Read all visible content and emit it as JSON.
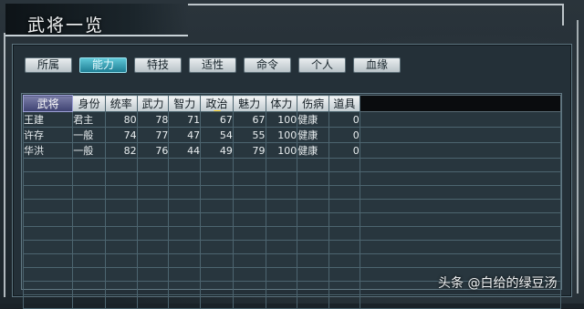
{
  "window": {
    "title": "武将一览"
  },
  "tabs": [
    {
      "label": "所属",
      "active": false
    },
    {
      "label": "能力",
      "active": true
    },
    {
      "label": "特技",
      "active": false
    },
    {
      "label": "适性",
      "active": false
    },
    {
      "label": "命令",
      "active": false
    },
    {
      "label": "个人",
      "active": false
    },
    {
      "label": "血缘",
      "active": false
    }
  ],
  "table": {
    "columns": [
      "武将",
      "身份",
      "统率",
      "武力",
      "智力",
      "政治",
      "魅力",
      "体力",
      "伤病",
      "道具"
    ],
    "selected_column": "武将",
    "sort_column": "政治",
    "rows": [
      {
        "name": "王建",
        "status": "君主",
        "lead": "80",
        "war": "78",
        "int": "71",
        "pol": "67",
        "cha": "67",
        "hp": "100",
        "injury": "健康",
        "item": "0"
      },
      {
        "name": "许存",
        "status": "一般",
        "lead": "74",
        "war": "77",
        "int": "47",
        "pol": "54",
        "cha": "55",
        "hp": "100",
        "injury": "健康",
        "item": "0"
      },
      {
        "name": "华洪",
        "status": "一般",
        "lead": "82",
        "war": "76",
        "int": "44",
        "pol": "49",
        "cha": "79",
        "hp": "100",
        "injury": "健康",
        "item": "0"
      }
    ]
  },
  "watermark": "头条 @白给的绿豆汤"
}
